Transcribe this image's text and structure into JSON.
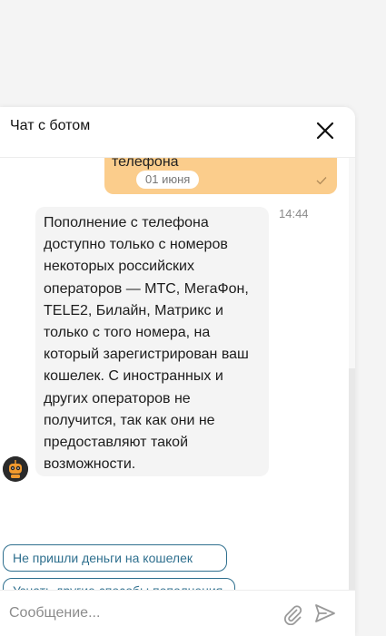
{
  "header": {
    "title": "Чат с ботом"
  },
  "messages": {
    "user_message_text": "телефона",
    "date_separator": "01 июня",
    "bot_message_text": "Пополнение с телефона доступно только с номеров некоторых российских операторов — МТС, МегаФон, TELE2, Билайн, Матрикс и только с того номера, на который зарегистрирован ваш кошелек. С иностранных и других операторов не получится, так как они не предоставляют такой возможности.",
    "bot_message_time": "14:44"
  },
  "quick_replies": [
    {
      "label": "Не пришли деньги на кошелек"
    },
    {
      "label": "Узнать другие способы пополнения"
    }
  ],
  "composer": {
    "placeholder": "Сообщение..."
  },
  "colors": {
    "user_bubble": "#fbcd8c",
    "bot_bubble": "#f4f4f4",
    "quick_reply_accent": "#2e6f8e"
  },
  "icons": {
    "close": "close-icon",
    "read_receipt": "check-icon",
    "bot_avatar": "robot-avatar-icon",
    "attach": "paperclip-icon",
    "send": "send-icon"
  }
}
